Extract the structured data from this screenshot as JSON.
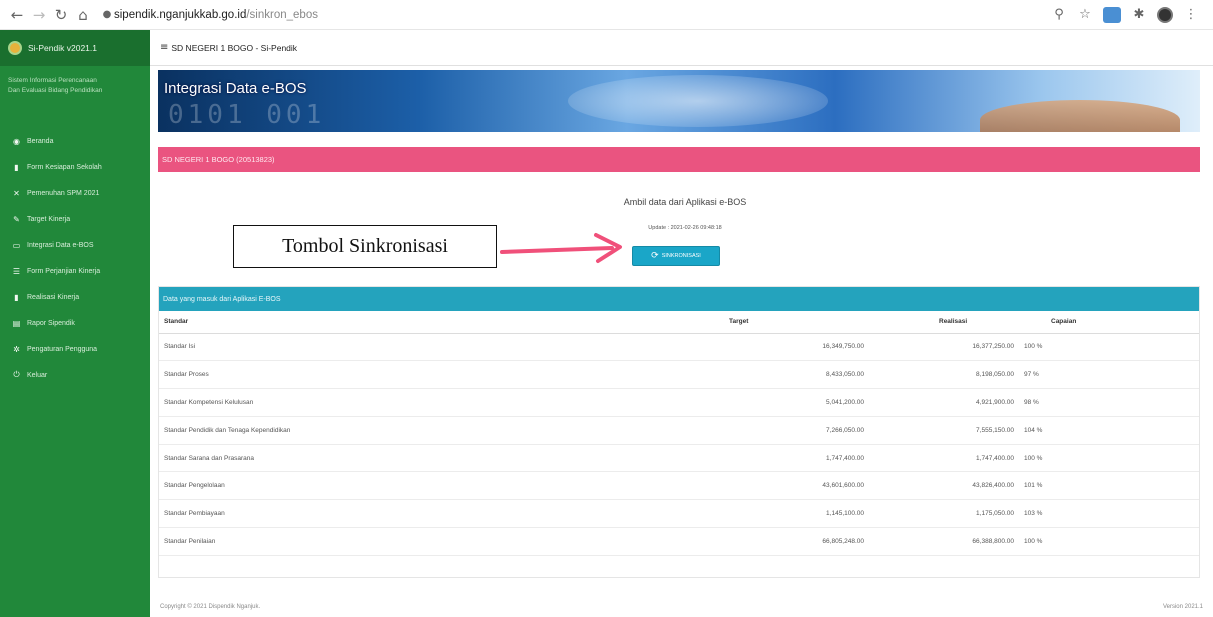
{
  "browser": {
    "url_host": "sipendik.nganjukkab.go.id",
    "url_path": "/sinkron_ebos"
  },
  "sidebar": {
    "brand": "Si-Pendik v2021.1",
    "tagline_1": "Sistem Informasi Perencanaan",
    "tagline_2": "Dan Evaluasi Bidang Pendidikan",
    "items": [
      {
        "label": "Beranda",
        "icon": "dashboard-icon"
      },
      {
        "label": "Form Kesiapan Sekolah",
        "icon": "file-icon"
      },
      {
        "label": "Pemenuhan SPM 2021",
        "icon": "close-icon"
      },
      {
        "label": "Target Kinerja",
        "icon": "edit-icon"
      },
      {
        "label": "Integrasi Data e-BOS",
        "icon": "monitor-icon"
      },
      {
        "label": "Form Perjanjian Kinerja",
        "icon": "list-icon"
      },
      {
        "label": "Realisasi Kinerja",
        "icon": "file-icon"
      },
      {
        "label": "Rapor Sipendik",
        "icon": "report-icon"
      },
      {
        "label": "Pengaturan Pengguna",
        "icon": "gears-icon"
      },
      {
        "label": "Keluar",
        "icon": "power-icon"
      }
    ]
  },
  "header": {
    "title": "SD NEGERI 1 BOGO  -  Si-Pendik"
  },
  "banner": {
    "title": "Integrasi Data e-BOS"
  },
  "school": {
    "label": "SD NEGERI 1 BOGO (20513823)"
  },
  "sync": {
    "title": "Ambil data dari Aplikasi e-BOS",
    "update": "Update : 2021-02-26 09:48:18",
    "button_label": "SINKRONISASI"
  },
  "annotation": {
    "text": "Tombol Sinkronisasi"
  },
  "panel": {
    "title": "Data yang masuk dari Aplikasi E-BOS",
    "columns": [
      "Standar",
      "Target",
      "Realisasi",
      "Capaian"
    ],
    "rows": [
      {
        "standar": "Standar Isi",
        "target": "16,349,750.00",
        "realisasi": "16,377,250.00",
        "capaian": "100 %"
      },
      {
        "standar": "Standar Proses",
        "target": "8,433,050.00",
        "realisasi": "8,198,050.00",
        "capaian": "97 %"
      },
      {
        "standar": "Standar Kompetensi Kelulusan",
        "target": "5,041,200.00",
        "realisasi": "4,921,900.00",
        "capaian": "98 %"
      },
      {
        "standar": "Standar Pendidik dan Tenaga Kependidikan",
        "target": "7,266,050.00",
        "realisasi": "7,555,150.00",
        "capaian": "104 %"
      },
      {
        "standar": "Standar Sarana dan Prasarana",
        "target": "1,747,400.00",
        "realisasi": "1,747,400.00",
        "capaian": "100 %"
      },
      {
        "standar": "Standar Pengelolaan",
        "target": "43,601,600.00",
        "realisasi": "43,826,400.00",
        "capaian": "101 %"
      },
      {
        "standar": "Standar Pembiayaan",
        "target": "1,145,100.00",
        "realisasi": "1,175,050.00",
        "capaian": "103 %"
      },
      {
        "standar": "Standar Penilaian",
        "target": "66,805,248.00",
        "realisasi": "66,388,800.00",
        "capaian": "100 %"
      }
    ]
  },
  "footer": {
    "copyright": "Copyright © 2021 Dispendik Nganjuk.",
    "version": "Version 2021.1"
  },
  "colors": {
    "sidebar": "#21883a",
    "school_bar": "#ea5480",
    "panel_header": "#24a3bd",
    "sync_button": "#1aa6c8",
    "annotation_arrow": "#f0507a"
  }
}
